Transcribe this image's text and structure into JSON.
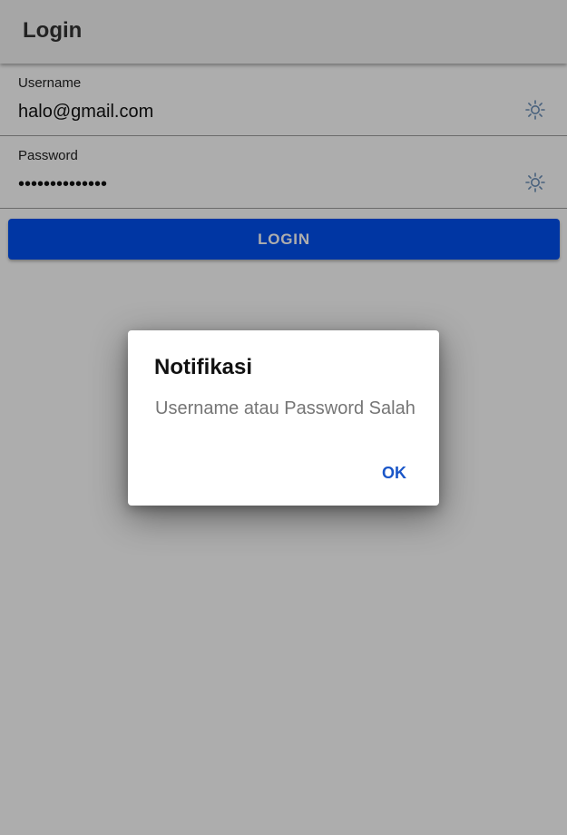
{
  "appbar": {
    "title": "Login"
  },
  "form": {
    "username": {
      "label": "Username",
      "value": "halo@gmail.com",
      "icon": "sun-icon"
    },
    "password": {
      "label": "Password",
      "value": "••••••••••••••",
      "icon": "sun-icon"
    },
    "login_label": "LOGIN"
  },
  "dialog": {
    "title": "Notifikasi",
    "message": "Username atau Password Salah",
    "ok_label": "OK"
  },
  "colors": {
    "primary": "#0050f0",
    "dialog_action": "#1a56c8",
    "scrim": "rgba(0,0,0,0.32)"
  }
}
